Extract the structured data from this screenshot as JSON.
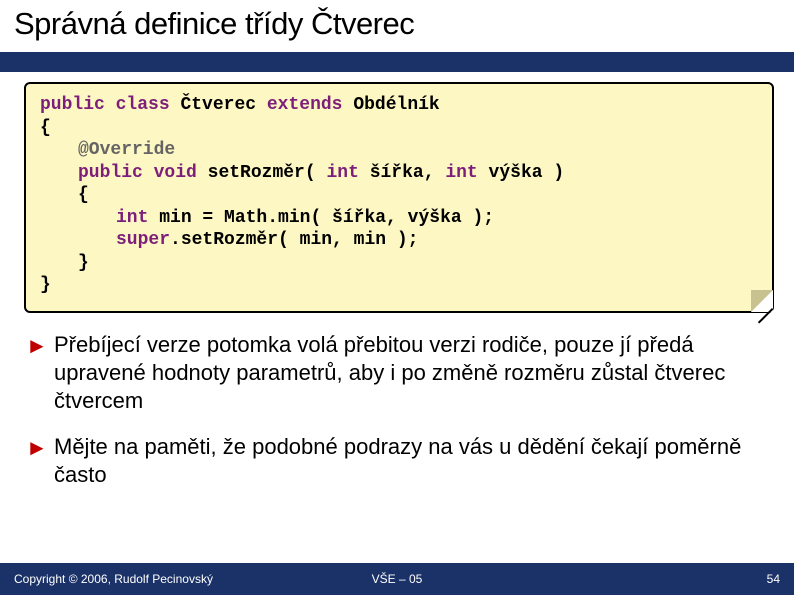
{
  "title": "Správná definice třídy Čtverec",
  "code": {
    "l1": {
      "p1": "public class",
      "p2": "Čtverec",
      "p3": "extends",
      "p4": "Obdélník"
    },
    "l2": "{",
    "l3": "@Override",
    "l4": {
      "p1": "public void",
      "p2": "setRozměr(",
      "p3": "int",
      "p4": "šířka,",
      "p5": "int",
      "p6": "výška )"
    },
    "l5": "{",
    "l6": {
      "p1": "int",
      "p2": "min = Math.min( šířka, výška );"
    },
    "l7": {
      "p1": "super",
      "p2": ".setRozměr( min, min );"
    },
    "l8": "}",
    "l9": "}"
  },
  "bullets": [
    "Přebíjecí verze potomka volá přebitou verzi rodiče, pouze jí předá upravené hodnoty parametrů, aby i po změně rozměru zůstal čtverec čtvercem",
    "Mějte na paměti, že podobné podrazy na vás u dědění čekají poměrně často"
  ],
  "footer": {
    "left": "Copyright © 2006, Rudolf Pecinovský",
    "center": "VŠE – 05",
    "right": "54"
  }
}
